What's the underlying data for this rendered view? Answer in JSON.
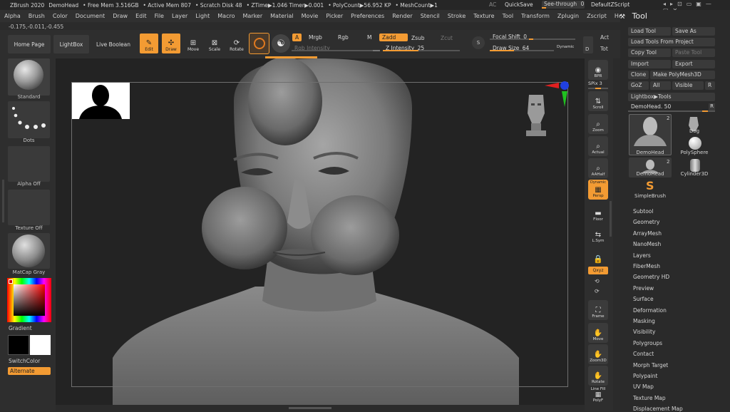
{
  "titlebar": {
    "app": "ZBrush 2020",
    "doc": "DemoHead",
    "free_mem": "• Free Mem 3.516GB",
    "active_mem": "• Active Mem 807",
    "scratch": "• Scratch Disk 48",
    "ztime": "• ZTime▶1.046 Timer▶0.001",
    "polycount": "• PolyCount▶56.952 KP",
    "meshcount": "• MeshCount▶1",
    "ac": "AC",
    "quicksave": "QuickSave",
    "seethrough": "See-through",
    "seethrough_value": "0",
    "script": "DefaultZScript"
  },
  "menus": [
    "Alpha",
    "Brush",
    "Color",
    "Document",
    "Draw",
    "Edit",
    "File",
    "Layer",
    "Light",
    "Macro",
    "Marker",
    "Material",
    "Movie",
    "Picker",
    "Preferences",
    "Render",
    "Stencil",
    "Stroke",
    "Texture",
    "Tool",
    "Transform",
    "Zplugin",
    "Zscript",
    "Help"
  ],
  "coords": "-0.175,-0.011,-0.455",
  "shelf": {
    "home": "Home Page",
    "lightbox": "LightBox",
    "liveboolean": "Live Boolean",
    "edit": "Edit",
    "draw": "Draw",
    "move": "Move",
    "scale": "Scale",
    "rotate": "Rotate",
    "a": "A",
    "mrgb": "Mrgb",
    "rgb": "Rgb",
    "m": "M",
    "zadd": "Zadd",
    "zsub": "Zsub",
    "zcut": "Zcut",
    "rgb_intensity": "Rgb Intensity",
    "z_intensity_label": "Z Intensity",
    "z_intensity_value": "25",
    "focal_label": "Focal Shift",
    "focal_value": "0",
    "drawsize_label": "Draw Size",
    "drawsize_value": "64",
    "dynamic": "Dynamic",
    "act": "Act",
    "tot": "Tot",
    "s": "S",
    "d": "D"
  },
  "lefttray": {
    "standard": "Standard",
    "dots": "Dots",
    "alpha_off": "Alpha Off",
    "texture_off": "Texture Off",
    "matcap": "MatCap Gray",
    "gradient": "Gradient",
    "switchcolor": "SwitchColor",
    "alternate": "Alternate"
  },
  "rightshelf": {
    "bpr": "BPR",
    "spix_label": "SPix",
    "spix_value": "3",
    "scroll": "Scroll",
    "zoom": "Zoom",
    "actual": "Actual",
    "aahalf": "AAHalf",
    "persp": "Persp",
    "dynamic": "Dynamic",
    "floor": "Floor",
    "lsym": "L.Sym",
    "xyz": "Qxyz",
    "frame": "Frame",
    "move": "Move",
    "zoom3d": "Zoom3D",
    "rotate": "Rotate",
    "linefill": "Line Fill",
    "polyf": "PolyF"
  },
  "tool": {
    "title": "Tool",
    "load_tool": "Load Tool",
    "save_as": "Save As",
    "load_from_project": "Load Tools From Project",
    "copy_tool": "Copy Tool",
    "paste_tool": "Paste Tool",
    "import": "Import",
    "export": "Export",
    "clone": "Clone",
    "make_polymesh": "Make PolyMesh3D",
    "goz": "GoZ",
    "all": "All",
    "visible": "Visible",
    "r": "R",
    "lightbox_tools": "Lightbox▶Tools",
    "demohead_slider_label": "DemoHead.",
    "demohead_slider_value": "50",
    "thumbs": {
      "demohead1": "DemoHead",
      "dog": "Dog",
      "polysphere": "PolySphere",
      "demohead2": "DemoHead",
      "cylinder": "Cylinder3D",
      "simplebrush": "SimpleBrush",
      "count1": "2",
      "count2": "2"
    },
    "sections": [
      "Subtool",
      "Geometry",
      "ArrayMesh",
      "NanoMesh",
      "Layers",
      "FiberMesh",
      "Geometry HD",
      "Preview",
      "Surface",
      "Deformation",
      "Masking",
      "Visibility",
      "Polygroups",
      "Contact",
      "Morph Target",
      "Polypaint",
      "UV Map",
      "Texture Map",
      "Displacement Map"
    ]
  },
  "colors": {
    "accent": "#f39b33",
    "bg": "#2b2b2b",
    "canvas": "#232323"
  }
}
